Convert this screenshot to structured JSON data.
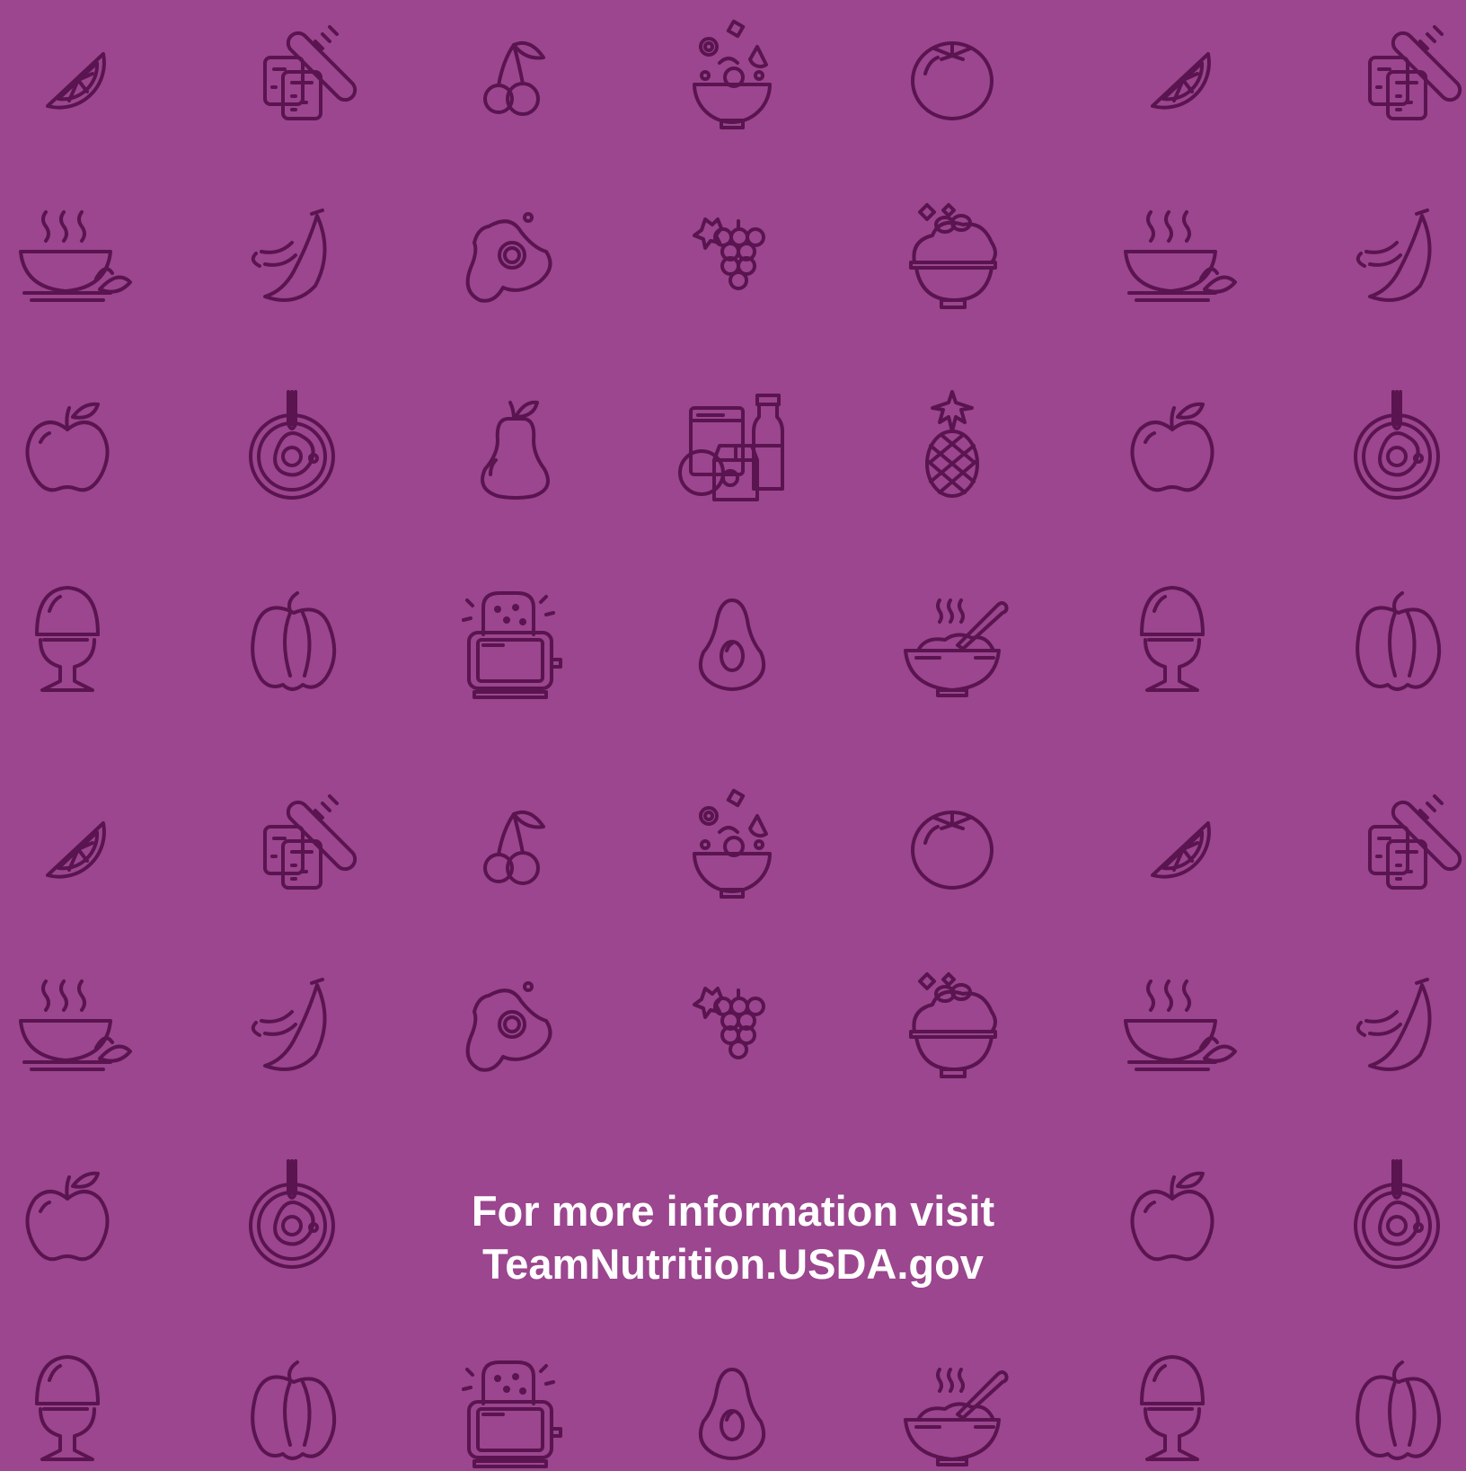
{
  "background_color": "#9b468f",
  "icon_color": "#5a1450",
  "text_color": "#ffffff",
  "pattern": {
    "rows": [
      [
        "orange-slice-icon",
        "bread-icon",
        "cherries-icon",
        "salad-bowl-icon",
        "tomato-icon",
        "orange-slice-icon",
        "bread-icon"
      ],
      [
        "soup-bowl-icon",
        "bananas-icon",
        "fried-egg-icon",
        "grapes-icon",
        "rice-bowl-icon",
        "soup-bowl-icon",
        "bananas-icon"
      ],
      [
        "apple-icon",
        "breakfast-plate-icon",
        "pear-icon",
        "groceries-icon",
        "pineapple-icon",
        "apple-icon",
        "breakfast-plate-icon"
      ],
      [
        "egg-cup-icon",
        "bell-pepper-icon",
        "toaster-icon",
        "avocado-icon",
        "cereal-bowl-icon",
        "egg-cup-icon",
        "bell-pepper-icon"
      ],
      [
        "orange-slice-icon",
        "bread-icon",
        "cherries-icon",
        "salad-bowl-icon",
        "tomato-icon",
        "orange-slice-icon",
        "bread-icon"
      ],
      [
        "soup-bowl-icon",
        "bananas-icon",
        "fried-egg-icon",
        "grapes-icon",
        "rice-bowl-icon",
        "soup-bowl-icon",
        "bananas-icon"
      ],
      [
        "apple-icon",
        "breakfast-plate-icon",
        null,
        null,
        null,
        "apple-icon",
        "breakfast-plate-icon"
      ],
      [
        "egg-cup-icon",
        "bell-pepper-icon",
        "toaster-icon",
        "avocado-icon",
        "cereal-bowl-icon",
        "egg-cup-icon",
        "bell-pepper-icon"
      ]
    ]
  },
  "footer": {
    "line1": "For more information visit",
    "line2": "TeamNutrition.USDA.gov"
  }
}
